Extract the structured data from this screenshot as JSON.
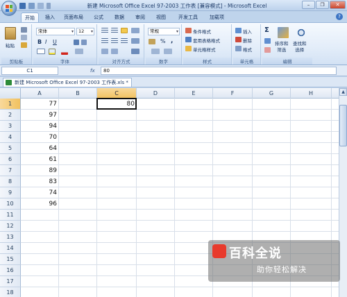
{
  "window": {
    "title": "新建 Microsoft Office Excel 97-2003 工作表 [兼容模式] - Microsoft Excel",
    "controls": {
      "minimize": "–",
      "restore": "❐",
      "close": "✕"
    }
  },
  "ribbon_tabs": [
    "开始",
    "插入",
    "页面布局",
    "公式",
    "数据",
    "审阅",
    "视图",
    "开发工具",
    "加载项"
  ],
  "ribbon": {
    "clipboard": {
      "label": "剪贴板",
      "paste": "粘贴"
    },
    "font": {
      "label": "字体",
      "font_name": "宋体",
      "font_size": "12",
      "bold": "B",
      "italic": "I",
      "underline": "U"
    },
    "alignment": {
      "label": "对齐方式"
    },
    "number": {
      "label": "数字",
      "format": "常规",
      "percent": "%",
      "comma": ","
    },
    "styles": {
      "label": "样式",
      "items": [
        "条件格式",
        "套用表格格式",
        "单元格样式"
      ]
    },
    "cells": {
      "label": "单元格",
      "items": [
        "插入",
        "删除",
        "格式"
      ]
    },
    "editing": {
      "label": "编辑",
      "sum": "Σ",
      "sort": "排序和\n筛选",
      "find": "查找和\n选择"
    }
  },
  "formula_bar": {
    "name_box": "C1",
    "fx": "fx",
    "content": "80"
  },
  "workbook_tab": "新建 Microsoft Office Excel 97-2003 工作表.xls *",
  "columns": [
    "A",
    "B",
    "C",
    "D",
    "E",
    "F",
    "G",
    "H"
  ],
  "rows": [
    "1",
    "2",
    "3",
    "4",
    "5",
    "6",
    "7",
    "8",
    "9",
    "10",
    "11",
    "12",
    "13",
    "14",
    "15",
    "16",
    "17",
    "18"
  ],
  "cells": {
    "A1": "77",
    "A2": "97",
    "A3": "94",
    "A4": "70",
    "A5": "64",
    "A6": "61",
    "A7": "89",
    "A8": "83",
    "A9": "74",
    "A10": "96",
    "C1": "80"
  },
  "selected_cell": "C1",
  "watermark": {
    "title": "百科全说",
    "subtitle": "助你轻松解决"
  },
  "colors": {
    "accent": "#f1c15f",
    "ribbon_bg": "#dbe7f6",
    "excel_green": "#2e8b3a"
  }
}
